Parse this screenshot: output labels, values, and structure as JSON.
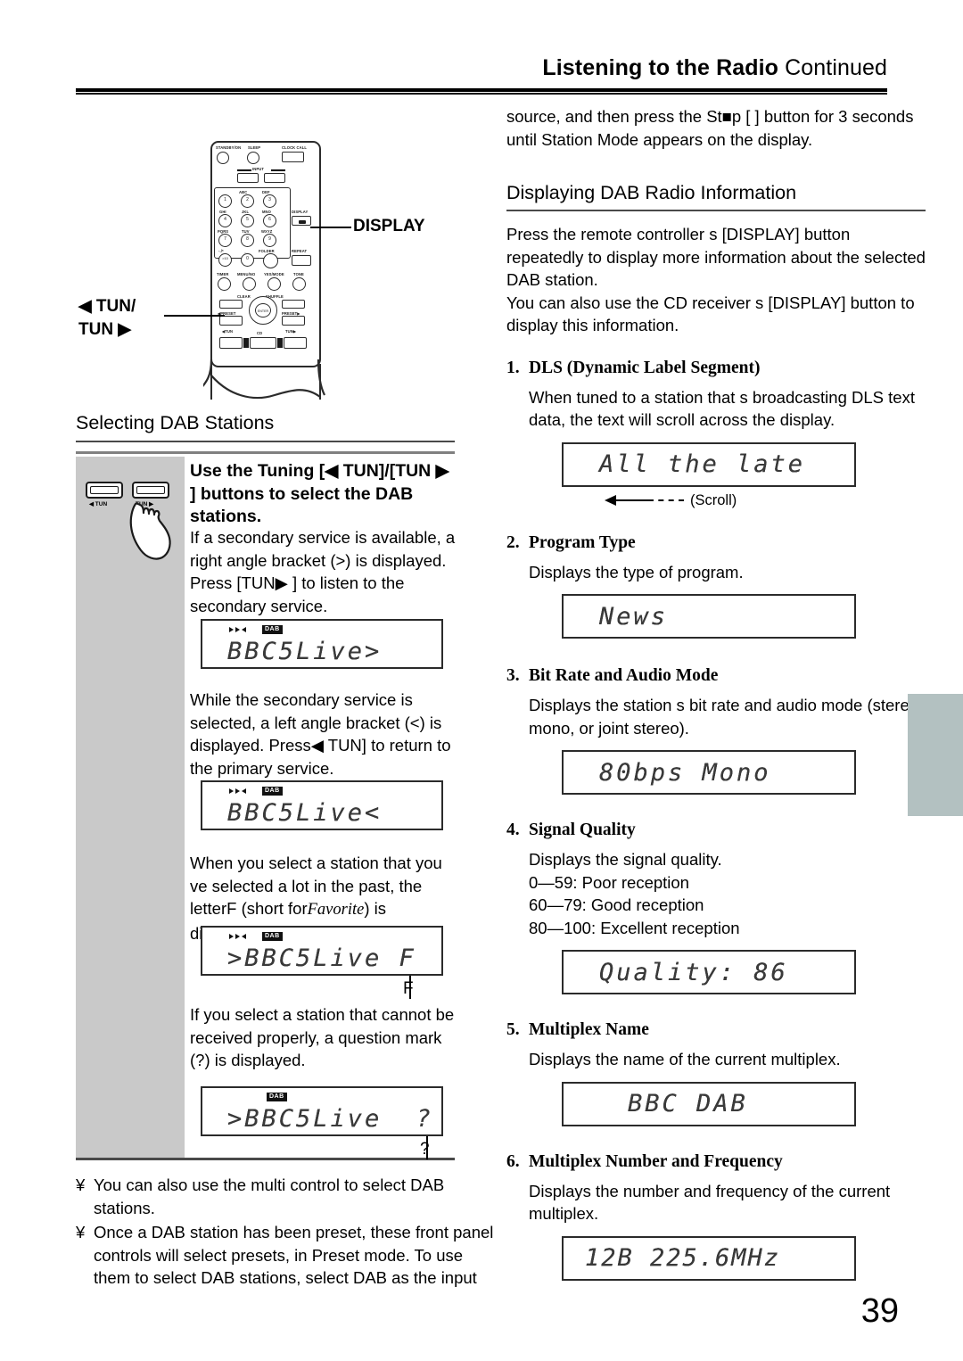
{
  "header": {
    "title_bold": "Listening to the Radio",
    "title_rest": " Continued"
  },
  "page_number": "39",
  "right_column": {
    "intro": "source, and then press the St■p [   ] button for 3 seconds until  Station Mode  appears on the display.",
    "section_heading": "Displaying DAB Radio Information",
    "section_intro_1": "Press the remote controller s [DISPLAY] button repeatedly to display more information about the selected DAB station.",
    "section_intro_2": "You can also use the CD receiver s [DISPLAY] button to display this information.",
    "items": [
      {
        "num": "1.",
        "title": "DLS (Dynamic Label Segment)",
        "body": "When tuned to a station that s broadcasting DLS text data, the text will scroll across the display.",
        "lcd": "All the late",
        "scroll_label": "(Scroll)"
      },
      {
        "num": "2.",
        "title": "Program Type",
        "body": "Displays the type of program.",
        "lcd": "News"
      },
      {
        "num": "3.",
        "title": "Bit Rate and Audio Mode",
        "body": "Displays the station s bit rate and audio mode (stereo, mono, or joint stereo).",
        "lcd": "80bps Mono"
      },
      {
        "num": "4.",
        "title": "Signal Quality",
        "body_lines": [
          "Displays the signal quality.",
          "0—59: Poor reception",
          "60—79: Good reception",
          "80—100: Excellent reception"
        ],
        "lcd": "Quality: 86"
      },
      {
        "num": "5.",
        "title": "Multiplex Name",
        "body": "Displays the name of the current multiplex.",
        "lcd": "BBC DAB"
      },
      {
        "num": "6.",
        "title": "Multiplex Number and Frequency",
        "body": "Displays the number and frequency of the current multiplex.",
        "lcd": "12B 225.6MHz"
      }
    ]
  },
  "left_column": {
    "callout_display": "DISPLAY",
    "callout_tun_line1": "◀ TUN/",
    "callout_tun_line2": "TUN ▶",
    "section_heading": "Selecting DAB Stations",
    "instruction_bold": "Use the Tuning [◀ TUN]/[TUN ▶ ] buttons to select the DAB stations.",
    "para_1": "If a secondary service is available, a right angle bracket (>) is displayed. Press [TUN▶ ] to listen to the secondary service.",
    "lcd_1": "BBC5Live>",
    "para_2": "While the secondary service is selected, a left angle bracket (<) is displayed. Press◀ TUN] to return to the primary service.",
    "lcd_2": "BBC5Live<",
    "para_3_a": "When you select a station that you ve selected a lot in the past, the letter",
    "para_3_b": "F",
    "para_3_c": "(short for",
    "para_3_d": "Favorite",
    "para_3_e": ") is displayed.",
    "lcd_3": ">BBC5Live F",
    "lcd_3_leader": "F",
    "para_4": "If you select a station that cannot be received properly, a question mark (?) is displayed.",
    "lcd_4": ">BBC5Live  ?",
    "lcd_4_leader": "?",
    "tun_button_left_label": "◀ TUN",
    "tun_button_right_label": "TUN ▶",
    "notes": [
      {
        "bullet": "¥",
        "text": "You can also use the multi control to select DAB stations."
      },
      {
        "bullet": "¥",
        "text": "Once a DAB station has been preset, these front panel controls will select presets, in Preset mode. To use them to select DAB stations, select DAB as the input"
      }
    ]
  },
  "remote": {
    "standby_label": "STANDBY/ON",
    "sleep_label": "SLEEP",
    "clock_call_label": "CLOCK CALL",
    "input_label": "INPUT",
    "display_label": "DISPLAY",
    "folder_label": "FOLDER",
    "repeat_label": "REPEAT",
    "timer_label": "TIMER",
    "menu_no_label": "MENU/NO",
    "yes_mode_label": "YES/MODE",
    "tone_label": "TONE",
    "clear_label": "CLEAR",
    "shuffle_label": "SHUFFLE",
    "preset_left_label": "◀PRESET",
    "preset_right_label": "PRESET▶",
    "tun_left_label": "◀TUN",
    "tun_right_label": "TUN▶",
    "enter_label": "ENTER",
    "cd_label": "CD",
    "keys": [
      {
        "num": "1",
        "alpha": ""
      },
      {
        "num": "2",
        "alpha": "ABC"
      },
      {
        "num": "3",
        "alpha": "DEF"
      },
      {
        "num": "4",
        "alpha": "GHI"
      },
      {
        "num": "5",
        "alpha": "JKL"
      },
      {
        "num": "6",
        "alpha": "MNO"
      },
      {
        "num": "7",
        "alpha": "PQRS"
      },
      {
        "num": "8",
        "alpha": "TUV"
      },
      {
        "num": "9",
        "alpha": "WXYZ"
      },
      {
        "num": ">10",
        "alpha": "-./*"
      },
      {
        "num": "0",
        "alpha": "_"
      }
    ]
  },
  "colors": {
    "grey_panel": "#c9c9c9",
    "side_tab": "#b3c1c1",
    "rule": "#4a4a4a"
  }
}
